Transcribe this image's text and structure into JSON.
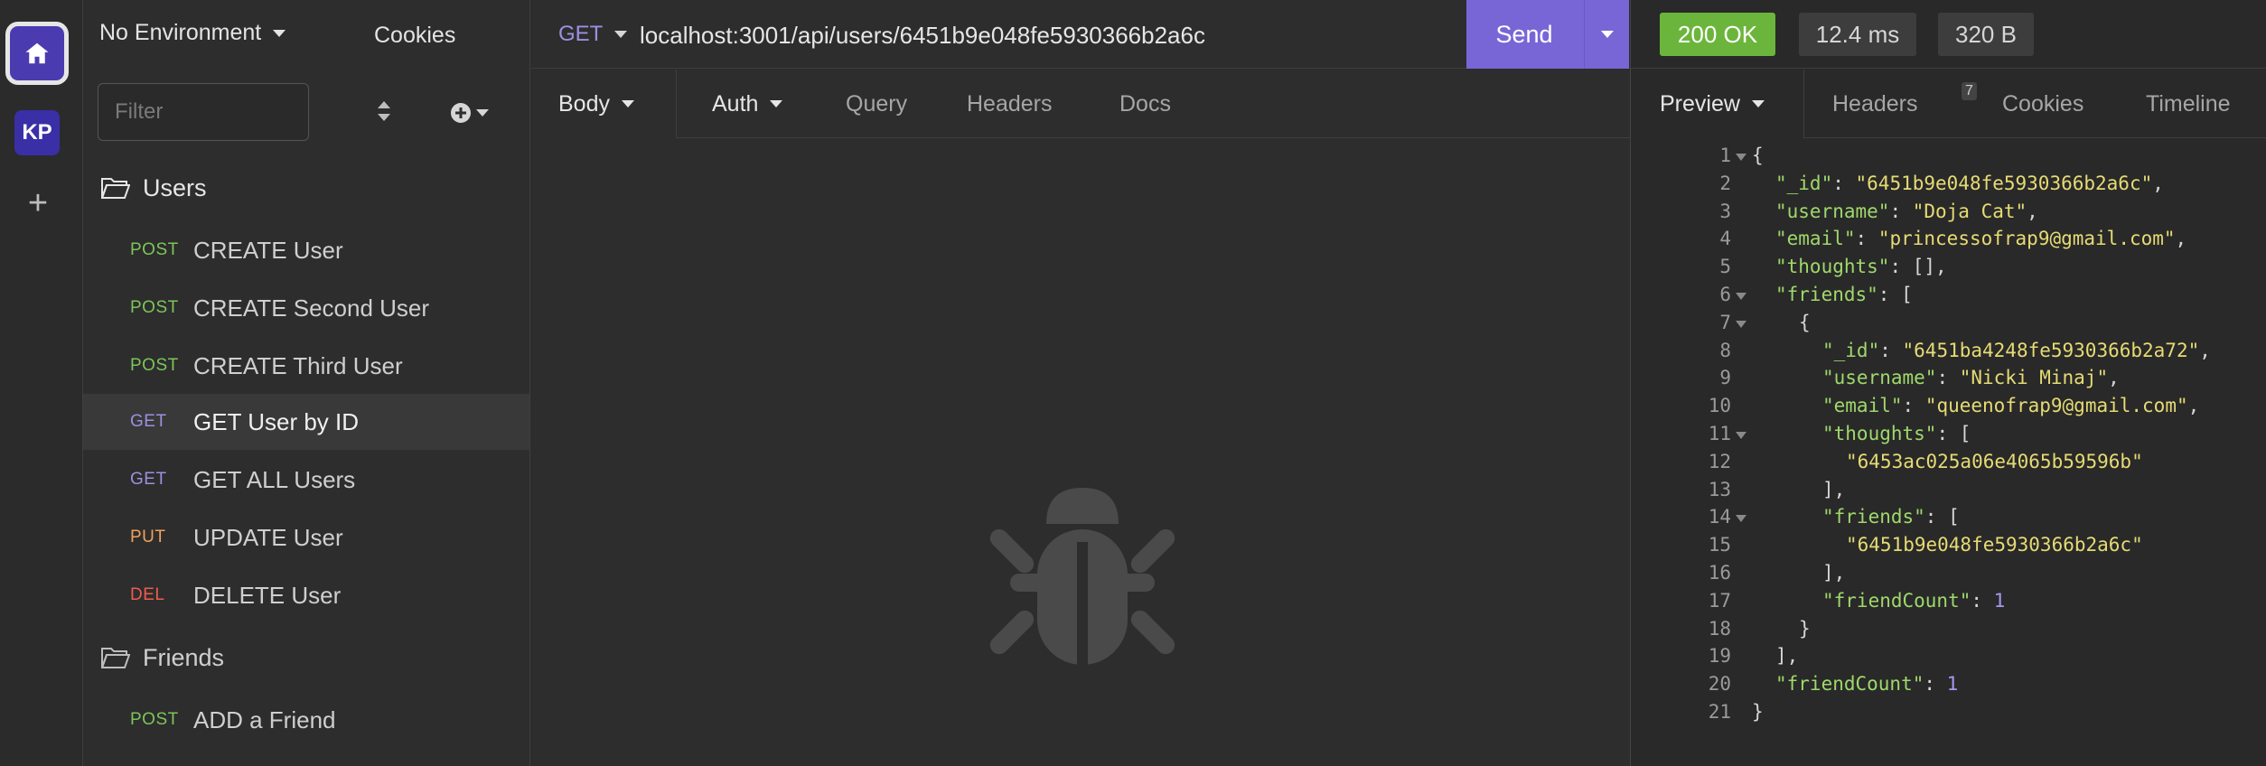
{
  "rail": {
    "workspace_initials": "KP"
  },
  "sidebar": {
    "environment": "No Environment",
    "cookies": "Cookies",
    "filter_placeholder": "Filter",
    "folders": [
      {
        "name": "Users"
      },
      {
        "name": "Friends"
      }
    ],
    "requests": [
      {
        "method": "POST",
        "name": "CREATE User"
      },
      {
        "method": "POST",
        "name": "CREATE Second User"
      },
      {
        "method": "POST",
        "name": "CREATE Third User"
      },
      {
        "method": "GET",
        "name": "GET User by ID",
        "active": true
      },
      {
        "method": "GET",
        "name": "GET ALL Users"
      },
      {
        "method": "PUT",
        "name": "UPDATE User"
      },
      {
        "method": "DEL",
        "name": "DELETE User"
      },
      {
        "method": "POST",
        "name": "ADD a Friend"
      }
    ]
  },
  "request": {
    "method": "GET",
    "url": "localhost:3001/api/users/6451b9e048fe5930366b2a6c",
    "send_label": "Send",
    "tabs": [
      "Body",
      "Auth",
      "Query",
      "Headers",
      "Docs"
    ]
  },
  "response": {
    "status": "200 OK",
    "time": "12.4 ms",
    "size": "320 B",
    "tabs": [
      "Preview",
      "Headers",
      "Cookies",
      "Timeline"
    ],
    "headers_count": "7",
    "body_lines": [
      {
        "n": "1",
        "fold": true,
        "indent": 0,
        "parts": [
          [
            "p",
            "{"
          ]
        ]
      },
      {
        "n": "2",
        "indent": 1,
        "parts": [
          [
            "k",
            "\"_id\""
          ],
          [
            "p",
            ": "
          ],
          [
            "s",
            "\"6451b9e048fe5930366b2a6c\""
          ],
          [
            "p",
            ","
          ]
        ]
      },
      {
        "n": "3",
        "indent": 1,
        "parts": [
          [
            "k",
            "\"username\""
          ],
          [
            "p",
            ": "
          ],
          [
            "s",
            "\"Doja Cat\""
          ],
          [
            "p",
            ","
          ]
        ]
      },
      {
        "n": "4",
        "indent": 1,
        "parts": [
          [
            "k",
            "\"email\""
          ],
          [
            "p",
            ": "
          ],
          [
            "s",
            "\"princessofrap9@gmail.com\""
          ],
          [
            "p",
            ","
          ]
        ]
      },
      {
        "n": "5",
        "indent": 1,
        "parts": [
          [
            "k",
            "\"thoughts\""
          ],
          [
            "p",
            ": [],"
          ]
        ]
      },
      {
        "n": "6",
        "fold": true,
        "indent": 1,
        "parts": [
          [
            "k",
            "\"friends\""
          ],
          [
            "p",
            ": ["
          ]
        ]
      },
      {
        "n": "7",
        "fold": true,
        "indent": 2,
        "parts": [
          [
            "p",
            "{"
          ]
        ]
      },
      {
        "n": "8",
        "indent": 3,
        "parts": [
          [
            "k",
            "\"_id\""
          ],
          [
            "p",
            ": "
          ],
          [
            "s",
            "\"6451ba4248fe5930366b2a72\""
          ],
          [
            "p",
            ","
          ]
        ]
      },
      {
        "n": "9",
        "indent": 3,
        "parts": [
          [
            "k",
            "\"username\""
          ],
          [
            "p",
            ": "
          ],
          [
            "s",
            "\"Nicki Minaj\""
          ],
          [
            "p",
            ","
          ]
        ]
      },
      {
        "n": "10",
        "indent": 3,
        "parts": [
          [
            "k",
            "\"email\""
          ],
          [
            "p",
            ": "
          ],
          [
            "s",
            "\"queenofrap9@gmail.com\""
          ],
          [
            "p",
            ","
          ]
        ]
      },
      {
        "n": "11",
        "fold": true,
        "indent": 3,
        "parts": [
          [
            "k",
            "\"thoughts\""
          ],
          [
            "p",
            ": ["
          ]
        ]
      },
      {
        "n": "12",
        "indent": 4,
        "parts": [
          [
            "s",
            "\"6453ac025a06e4065b59596b\""
          ]
        ]
      },
      {
        "n": "13",
        "indent": 3,
        "parts": [
          [
            "p",
            "],"
          ]
        ]
      },
      {
        "n": "14",
        "fold": true,
        "indent": 3,
        "parts": [
          [
            "k",
            "\"friends\""
          ],
          [
            "p",
            ": ["
          ]
        ]
      },
      {
        "n": "15",
        "indent": 4,
        "parts": [
          [
            "s",
            "\"6451b9e048fe5930366b2a6c\""
          ]
        ]
      },
      {
        "n": "16",
        "indent": 3,
        "parts": [
          [
            "p",
            "],"
          ]
        ]
      },
      {
        "n": "17",
        "indent": 3,
        "parts": [
          [
            "k",
            "\"friendCount\""
          ],
          [
            "p",
            ": "
          ],
          [
            "n",
            "1"
          ]
        ]
      },
      {
        "n": "18",
        "indent": 2,
        "parts": [
          [
            "p",
            "}"
          ]
        ]
      },
      {
        "n": "19",
        "indent": 1,
        "parts": [
          [
            "p",
            "],"
          ]
        ]
      },
      {
        "n": "20",
        "indent": 1,
        "parts": [
          [
            "k",
            "\"friendCount\""
          ],
          [
            "p",
            ": "
          ],
          [
            "n",
            "1"
          ]
        ]
      },
      {
        "n": "21",
        "indent": 0,
        "parts": [
          [
            "p",
            "}"
          ]
        ]
      }
    ]
  }
}
